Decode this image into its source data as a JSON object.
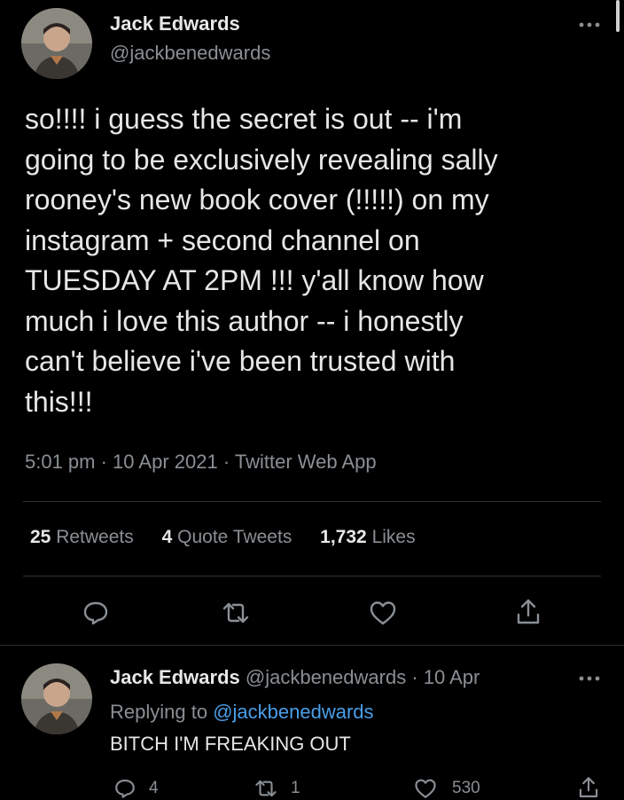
{
  "main_tweet": {
    "author_name": "Jack Edwards",
    "author_handle": "@jackbenedwards",
    "text_lines": [
      "so!!!! i guess the secret is out -- i'm",
      "going to be exclusively revealing sally",
      "rooney's new book cover (!!!!!) on my",
      "instagram + second channel on",
      "TUESDAY AT 2PM !!! y'all know how",
      "much i love this author -- i honestly",
      "can't believe i've been trusted with",
      "this!!!"
    ],
    "meta": "5:01 pm · 10 Apr 2021 · Twitter Web App",
    "stats": {
      "retweets_count": "25",
      "retweets_label": "Retweets",
      "quotes_count": "4",
      "quotes_label": "Quote Tweets",
      "likes_count": "1,732",
      "likes_label": "Likes"
    },
    "icons": [
      "reply-icon",
      "retweet-icon",
      "like-icon",
      "share-icon",
      "more-icon"
    ]
  },
  "reply_tweet": {
    "author_name": "Jack Edwards",
    "author_handle": "@jackbenedwards",
    "date": "· 10 Apr",
    "replying_prefix": "Replying to",
    "replying_handle": "@jackbenedwards",
    "text": "BITCH I'M FREAKING OUT",
    "reply_count": "4",
    "retweet_count": "1",
    "like_count": "530"
  },
  "colors": {
    "background": "#000000",
    "text": "#d9d9d9",
    "muted": "#8a8f94",
    "link": "#4a9fe8",
    "divider": "#2f3336"
  }
}
